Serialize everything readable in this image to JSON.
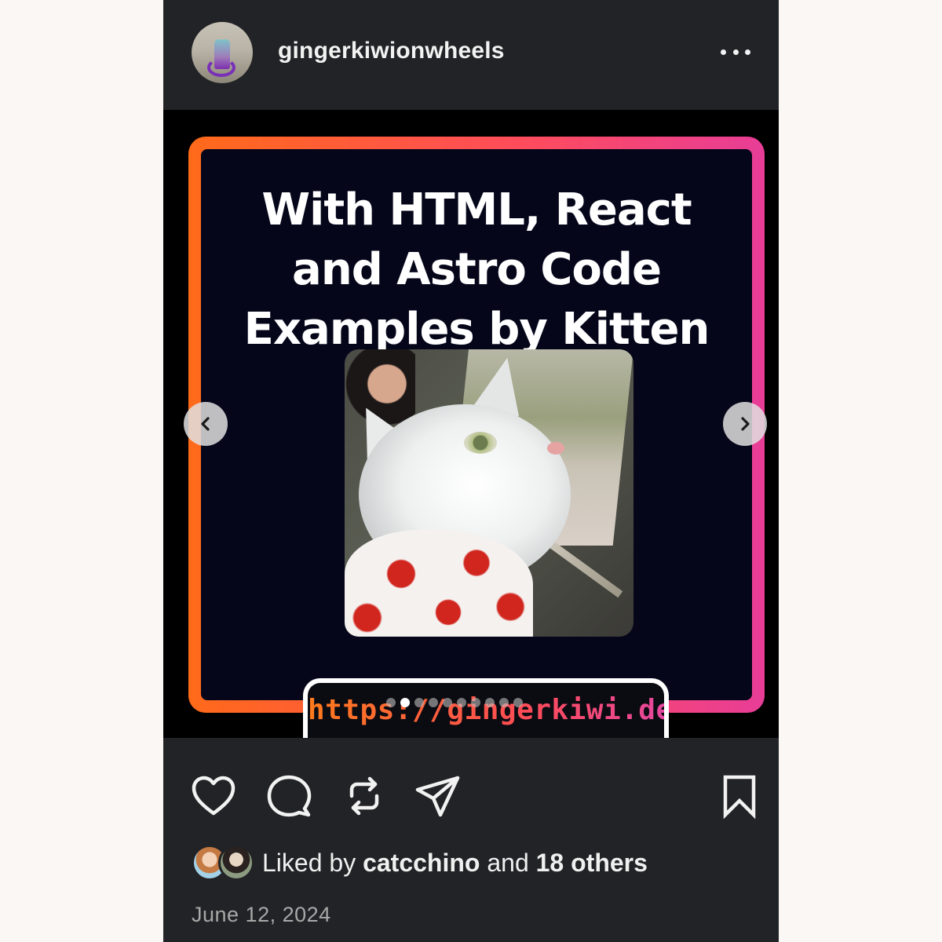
{
  "post": {
    "username": "gingerkiwionwheels",
    "more_icon": "more-horizontal-icon",
    "media": {
      "slide_title": "With HTML, React and Astro Code Examples by Kitten",
      "url": "https://gingerkiwi.dev",
      "photo_subject": "white cat in Canada flag bandana",
      "slide_count": 10,
      "active_slide": 2,
      "prev_icon": "chevron-left-icon",
      "next_icon": "chevron-right-icon"
    },
    "actions": {
      "like_icon": "heart-icon",
      "comment_icon": "comment-icon",
      "repost_icon": "repost-icon",
      "share_icon": "send-icon",
      "save_icon": "bookmark-icon"
    },
    "likes": {
      "prefix": "Liked by",
      "user": "catcchino",
      "conjunction": "and",
      "others": "18 others"
    },
    "date": "June 12, 2024"
  },
  "colors": {
    "page_background": "#fbf7f4",
    "post_background": "#222326",
    "frame_gradient_start": "#ff6a1a",
    "frame_gradient_end": "#e83d97",
    "slide_background": "#05061a"
  }
}
